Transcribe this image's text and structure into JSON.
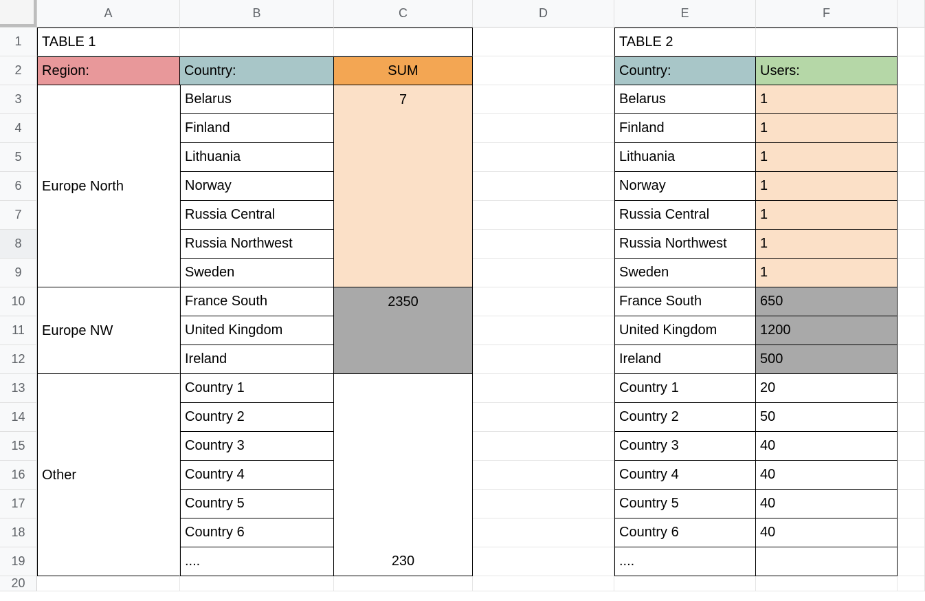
{
  "columns": [
    "A",
    "B",
    "C",
    "D",
    "E",
    "F"
  ],
  "rows": [
    "1",
    "2",
    "3",
    "4",
    "5",
    "6",
    "7",
    "8",
    "9",
    "10",
    "11",
    "12",
    "13",
    "14",
    "15",
    "16",
    "17",
    "18",
    "19",
    "20"
  ],
  "table1": {
    "title": "TABLE 1",
    "headers": {
      "region": "Region:",
      "country": "Country:",
      "sum": "SUM"
    },
    "groups": [
      {
        "region": "Europe North",
        "sum": "7",
        "countries": [
          "Belarus",
          "Finland",
          "Lithuania",
          "Norway",
          "Russia Central",
          "Russia Northwest",
          "Sweden"
        ]
      },
      {
        "region": "Europe NW",
        "sum": "2350",
        "countries": [
          "France South",
          "United Kingdom",
          "Ireland"
        ]
      },
      {
        "region": "Other",
        "sum": "230",
        "countries": [
          "Country 1",
          "Country 2",
          "Country 3",
          "Country 4",
          "Country 5",
          "Country 6",
          "...."
        ]
      }
    ]
  },
  "table2": {
    "title": "TABLE 2",
    "headers": {
      "country": "Country:",
      "users": "Users:"
    },
    "rows": [
      {
        "country": "Belarus",
        "users": "1",
        "bg": "peach"
      },
      {
        "country": "Finland",
        "users": "1",
        "bg": "peach"
      },
      {
        "country": "Lithuania",
        "users": "1",
        "bg": "peach"
      },
      {
        "country": "Norway",
        "users": "1",
        "bg": "peach"
      },
      {
        "country": "Russia Central",
        "users": "1",
        "bg": "peach"
      },
      {
        "country": "Russia Northwest",
        "users": "1",
        "bg": "peach"
      },
      {
        "country": "Sweden",
        "users": "1",
        "bg": "peach"
      },
      {
        "country": "France South",
        "users": "650",
        "bg": "gray"
      },
      {
        "country": "United Kingdom",
        "users": "1200",
        "bg": "gray"
      },
      {
        "country": "Ireland",
        "users": "500",
        "bg": "gray"
      },
      {
        "country": "Country 1",
        "users": "20",
        "bg": "white"
      },
      {
        "country": "Country 2",
        "users": "50",
        "bg": "white"
      },
      {
        "country": "Country 3",
        "users": "40",
        "bg": "white"
      },
      {
        "country": "Country 4",
        "users": "40",
        "bg": "white"
      },
      {
        "country": "Country 5",
        "users": "40",
        "bg": "white"
      },
      {
        "country": "Country 6",
        "users": "40",
        "bg": "white"
      },
      {
        "country": "....",
        "users": "",
        "bg": "white"
      }
    ]
  }
}
